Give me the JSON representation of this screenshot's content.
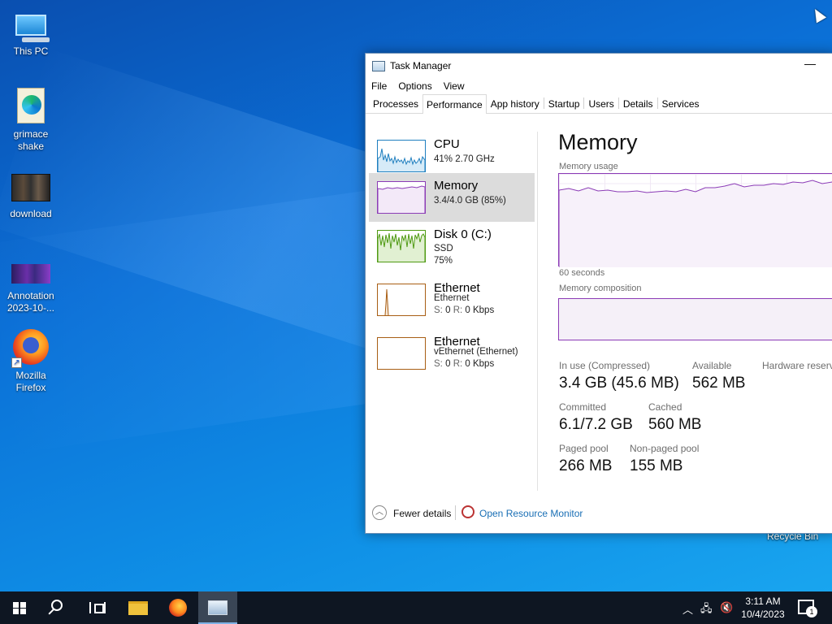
{
  "desktop": {
    "icons": [
      {
        "label": "This PC"
      },
      {
        "label": "grimace shake"
      },
      {
        "label": "download"
      },
      {
        "label": "Annotation 2023-10-..."
      },
      {
        "label": "Mozilla Firefox"
      }
    ],
    "recycle_bin_label": "Recycle Bin"
  },
  "task_manager": {
    "title": "Task Manager",
    "minimize_glyph": "—",
    "menu": [
      "File",
      "Options",
      "View"
    ],
    "tabs": [
      "Processes",
      "Performance",
      "App history",
      "Startup",
      "Users",
      "Details",
      "Services"
    ],
    "active_tab": "Performance",
    "perf_list": [
      {
        "title": "CPU",
        "line1": "41%  2.70 GHz",
        "line2": ""
      },
      {
        "title": "Memory",
        "line1": "3.4/4.0 GB (85%)",
        "line2": ""
      },
      {
        "title": "Disk 0 (C:)",
        "line1": "SSD",
        "line2": "75%"
      },
      {
        "title": "Ethernet",
        "line1": "Ethernet",
        "line2_s": "S:",
        "line2_sv": "0",
        "line2_r": "R:",
        "line2_rv": "0 Kbps"
      },
      {
        "title": "Ethernet",
        "line1": "vEthernet (Ethernet)",
        "line2_s": "S:",
        "line2_sv": "0",
        "line2_r": "R:",
        "line2_rv": "0 Kbps"
      }
    ],
    "detail": {
      "heading": "Memory",
      "usage_label": "Memory usage",
      "time_label": "60 seconds",
      "composition_label": "Memory composition",
      "stats": [
        {
          "label": "In use (Compressed)",
          "value": "3.4 GB (45.6 MB)"
        },
        {
          "label": "Available",
          "value": "562 MB"
        },
        {
          "label": "Hardware reserve",
          "value": ""
        },
        {
          "label": "Committed",
          "value": "6.1/7.2 GB"
        },
        {
          "label": "Cached",
          "value": "560 MB"
        },
        {
          "label": "Paged pool",
          "value": "266 MB"
        },
        {
          "label": "Non-paged pool",
          "value": "155 MB"
        }
      ]
    },
    "footer": {
      "fewer_details": "Fewer details",
      "open_resource_monitor": "Open Resource Monitor"
    },
    "colors": {
      "memory_accent": "#8b3bb6",
      "cpu_accent": "#1f7fbf",
      "disk_accent": "#4f9a12",
      "ethernet_accent": "#a85e14",
      "link": "#1a6fb5"
    }
  },
  "taskbar": {
    "clock_time": "3:11 AM",
    "clock_date": "10/4/2023",
    "notification_count": "1",
    "icons": [
      "windows-start-icon",
      "search-icon",
      "task-view-icon",
      "file-explorer-icon",
      "firefox-icon",
      "task-manager-icon"
    ]
  }
}
